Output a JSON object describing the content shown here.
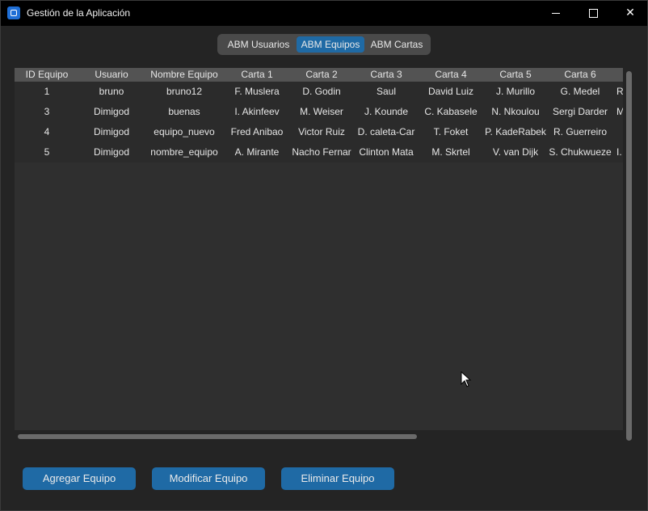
{
  "window": {
    "title": "Gestión de la Aplicación",
    "icon": "app-icon",
    "accent": "#1f6aa5"
  },
  "tabs": [
    {
      "label": "ABM Usuarios",
      "selected": false
    },
    {
      "label": "ABM Equipos",
      "selected": true
    },
    {
      "label": "ABM Cartas",
      "selected": false
    }
  ],
  "table": {
    "columns": [
      "ID Equipo",
      "Usuario",
      "Nombre Equipo",
      "Carta 1",
      "Carta 2",
      "Carta 3",
      "Carta 4",
      "Carta 5",
      "Carta 6",
      ""
    ],
    "rows": [
      [
        "1",
        "bruno",
        "bruno12",
        "F. Muslera",
        "D. Godin",
        "Saul",
        "David Luiz",
        "J. Murillo",
        "G. Medel",
        "R"
      ],
      [
        "3",
        "Dimigod",
        "buenas",
        "I. Akinfeev",
        "M. Weiser",
        "J. Kounde",
        "C. Kabasele",
        "N. Nkoulou",
        "Sergi Darder",
        "M"
      ],
      [
        "4",
        "Dimigod",
        "equipo_nuevo",
        "Fred Anibao",
        "Victor Ruiz",
        "D. caleta-Car",
        "T. Foket",
        "P. KadeRabek",
        "R. Guerreiro",
        ""
      ],
      [
        "5",
        "Dimigod",
        "nombre_equipo",
        "A. Mirante",
        "Nacho Fernar",
        "Clinton Mata",
        "M. Skrtel",
        "V. van Dijk",
        "S. Chukwueze",
        "I."
      ]
    ]
  },
  "buttons": {
    "add": "Agregar Equipo",
    "modify": "Modificar Equipo",
    "delete": "Eliminar Equipo"
  }
}
